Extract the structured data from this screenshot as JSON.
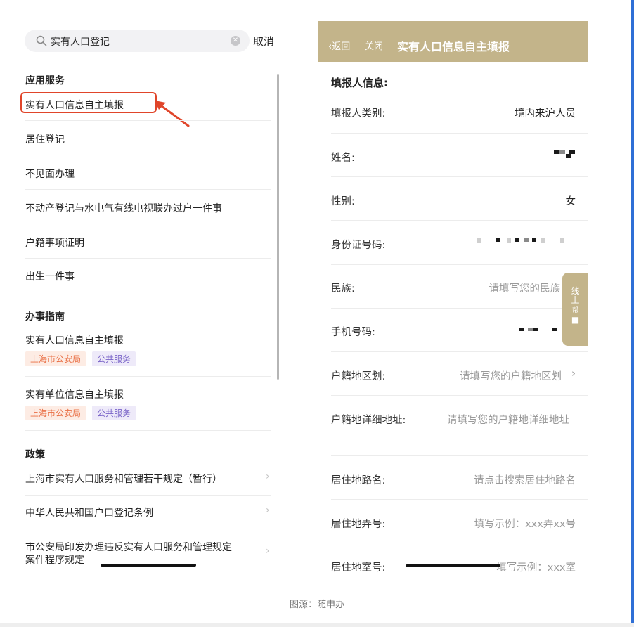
{
  "search": {
    "query": "实有人口登记",
    "cancel_label": "取消"
  },
  "app_services": {
    "title": "应用服务",
    "items": [
      "实有人口信息自主填报",
      "居住登记",
      "不见面办理",
      "不动产登记与水电气有线电视联办过户一件事",
      "户籍事项证明",
      "出生一件事"
    ]
  },
  "guides": {
    "title": "办事指南",
    "items": [
      {
        "label": "实有人口信息自主填报",
        "tags": [
          "上海市公安局",
          "公共服务"
        ]
      },
      {
        "label": "实有单位信息自主填报",
        "tags": [
          "上海市公安局",
          "公共服务"
        ]
      }
    ]
  },
  "policy": {
    "title": "政策",
    "items": [
      "上海市实有人口服务和管理若干规定（暂行）",
      "中华人民共和国户口登记条例",
      "市公安局印发办理违反实有人口服务和管理规定",
      "案件程序规定"
    ]
  },
  "form": {
    "header": {
      "back": "返回",
      "close": "关闭",
      "title": "实有人口信息自主填报"
    },
    "section_title": "填报人信息:",
    "rows": [
      {
        "label": "填报人类别:",
        "value": "境内来沪人员"
      },
      {
        "label": "姓名:",
        "value": ""
      },
      {
        "label": "性别:",
        "value": "女"
      },
      {
        "label": "身份证号码:",
        "value": ""
      },
      {
        "label": "民族:",
        "placeholder": "请填写您的民族"
      },
      {
        "label": "手机号码:",
        "value": ""
      },
      {
        "label": "户籍地区划:",
        "placeholder": "请填写您的户籍地区划"
      },
      {
        "label": "户籍地详细地址:",
        "placeholder": "请填写您的户籍地详细地址"
      },
      {
        "label": "居住地路名:",
        "placeholder": "请点击搜索居住地路名"
      },
      {
        "label": "居住地弄号:",
        "placeholder": "填写示例：xxx弄xx号"
      },
      {
        "label": "居住地室号:",
        "placeholder": "填写示例：xxx室"
      }
    ],
    "side_tab": "线上\n帮\n■"
  },
  "caption": "图源：随申办",
  "colors": {
    "header_gold": "#c3b48a",
    "highlight_red": "#e0452a",
    "org_tag": "#e96f45",
    "service_tag": "#7a64c8"
  }
}
